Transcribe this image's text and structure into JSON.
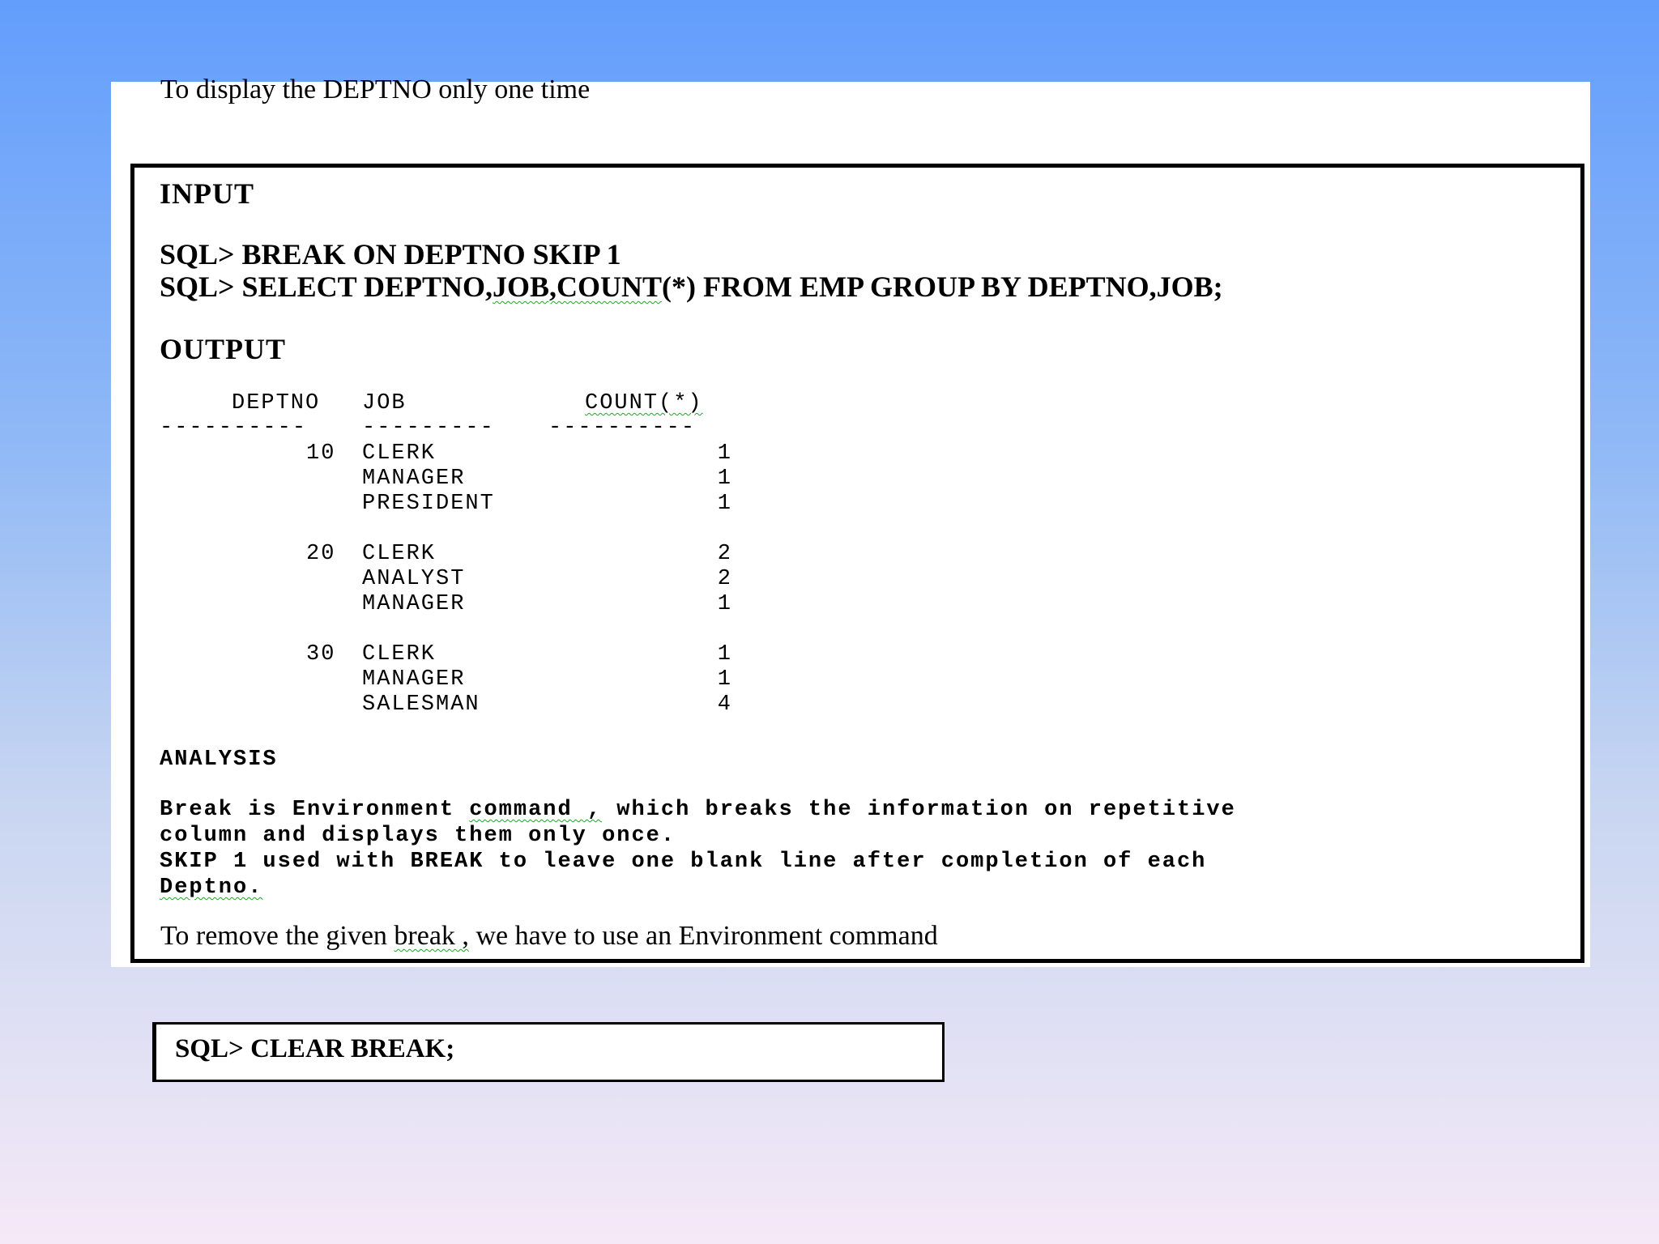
{
  "intro": "To display the DEPTNO only one time",
  "input": {
    "heading": "INPUT",
    "line1": "SQL> BREAK ON DEPTNO SKIP 1",
    "line2_prefix": "SQL> SELECT DEPTNO,",
    "line2_squiggle": "JOB,COUNT",
    "line2_suffix": "(*) FROM EMP GROUP BY DEPTNO,JOB;"
  },
  "output": {
    "heading": "OUTPUT",
    "columns": [
      "DEPTNO",
      "JOB",
      "COUNT(*)"
    ],
    "separators": [
      "----------",
      "---------",
      "----------"
    ],
    "rows": [
      {
        "deptno": "10",
        "job": "CLERK",
        "count": "1"
      },
      {
        "deptno": "",
        "job": "MANAGER",
        "count": "1"
      },
      {
        "deptno": "",
        "job": "PRESIDENT",
        "count": "1"
      },
      {
        "deptno": "20",
        "job": "CLERK",
        "count": "2"
      },
      {
        "deptno": "",
        "job": "ANALYST",
        "count": "2"
      },
      {
        "deptno": "",
        "job": "MANAGER",
        "count": "1"
      },
      {
        "deptno": "30",
        "job": "CLERK",
        "count": "1"
      },
      {
        "deptno": "",
        "job": "MANAGER",
        "count": "1"
      },
      {
        "deptno": "",
        "job": "SALESMAN",
        "count": "4"
      }
    ]
  },
  "analysis": {
    "heading": "ANALYSIS",
    "p1_a": "Break is Environment ",
    "p1_squiggle": "command ,",
    "p1_b": " which breaks the information on repetitive",
    "p1_c": "column and displays them only once.",
    "p2_a": "SKIP 1 used with BREAK to leave one blank line after completion of each",
    "p2_squiggle": "Deptno."
  },
  "remove": {
    "a": "To remove the given ",
    "squiggle": "break ,",
    "b": " we have to use an Environment command"
  },
  "clear_command": "SQL> CLEAR BREAK;"
}
